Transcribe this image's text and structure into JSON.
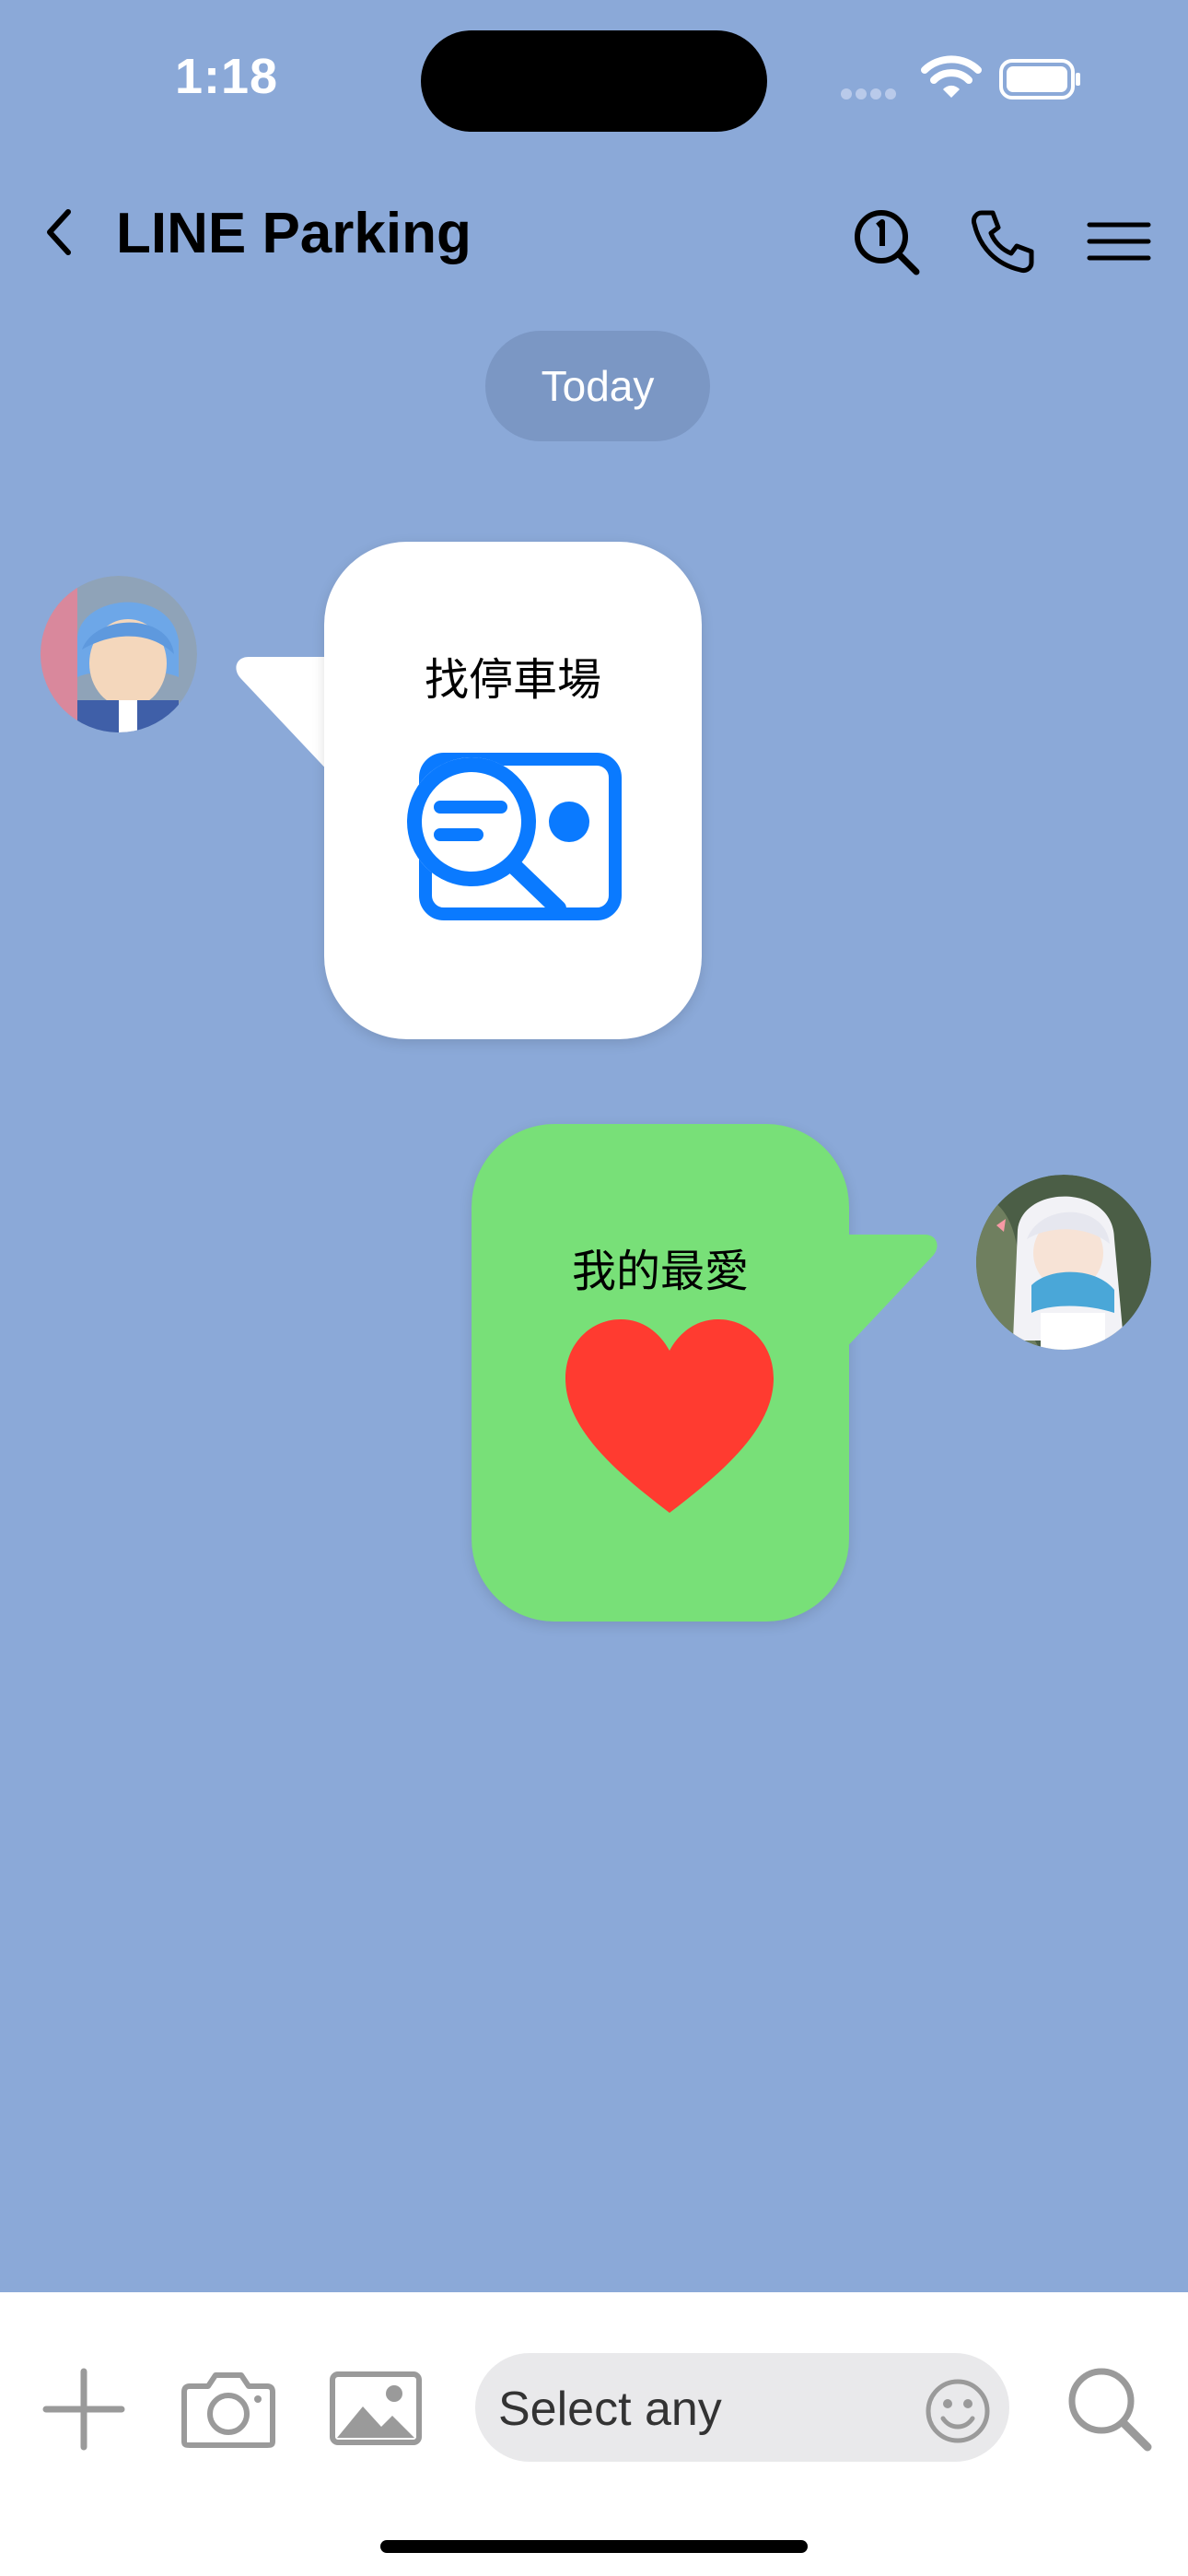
{
  "status_bar": {
    "time": "1:18"
  },
  "header": {
    "title": "LINE Parking"
  },
  "chat": {
    "date_label": "Today",
    "messages": [
      {
        "side": "left",
        "text": "找停車場",
        "icon": "search-card-icon"
      },
      {
        "side": "right",
        "text": "我的最愛",
        "icon": "heart-icon"
      }
    ]
  },
  "input": {
    "placeholder": "Select any"
  },
  "colors": {
    "background": "#8BA9D8",
    "incoming_bubble": "#FFFFFF",
    "outgoing_bubble": "#78E078",
    "accent_blue": "#0A7AFF",
    "heart_red": "#FF3B30"
  }
}
